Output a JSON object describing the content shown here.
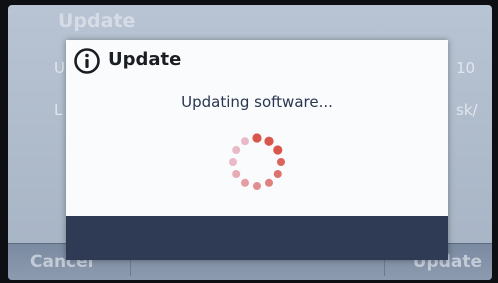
{
  "background": {
    "title": "Update",
    "row1_left": "U",
    "row1_right": "10",
    "row2_left": "L",
    "row2_right": "sk/"
  },
  "bottom_bar": {
    "cancel_label": "Cancel",
    "update_label": "Update"
  },
  "dialog": {
    "icon": "info-icon",
    "title": "Update",
    "message": "Updating software...",
    "spinner": "loading-spinner-icon"
  },
  "colors": {
    "accent": "#2f3b54",
    "spinner_active": "#d9574a",
    "spinner_faded": "#e9b9c8"
  }
}
